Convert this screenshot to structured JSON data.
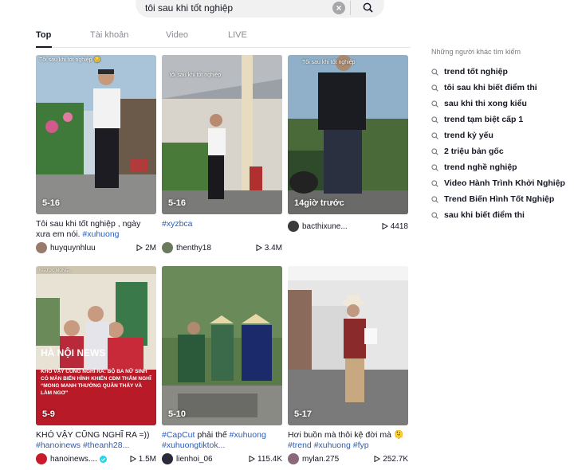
{
  "search": {
    "query": "tôi sau khi tốt nghiệp"
  },
  "tabs": [
    {
      "label": "Top"
    },
    {
      "label": "Tài khoản"
    },
    {
      "label": "Video"
    },
    {
      "label": "LIVE"
    }
  ],
  "videos": [
    {
      "date": "5-16",
      "overlay": "Tôi sau khi tốt nghiệp 😔",
      "desc_text": "Tôi sau khi tốt nghiệp , ngày xưa em nói. ",
      "desc_tags": "#xuhuong",
      "author": "huyquynhluu",
      "views": "2M"
    },
    {
      "date": "5-16",
      "overlay": "tôi sau khi tốt nghiệp",
      "desc_text": "",
      "desc_tags": "#xyzbca",
      "author": "thenthy18",
      "views": "3.4M"
    },
    {
      "date": "14giờ trước",
      "overlay": "Tôi sau khi tốt nghiệp",
      "desc_text": "",
      "desc_tags": "",
      "author": "bacthixune...",
      "views": "4418"
    },
    {
      "date": "5-9",
      "overlay": "NGƯỢC MONG...",
      "news_title": "HÀ NỘI NEWS",
      "news_sub": "KHÓ VẬY CŨNG NGHĨ RA: BỘ BA NỮ SINH CÓ MÀN BIẾN HÌNH KHIẾN CĐM THẮM NGHĨ “MONG MANH THƯỜNG QUÂN THẤY VÀ LÀM NGƠ”",
      "desc_text": "KHÓ VẬY CŨNG NGHĨ RA =)) ",
      "desc_tags": "#hanoinews #theanh28...",
      "author": "hanoinews....",
      "verified": true,
      "views": "1.5M"
    },
    {
      "date": "5-10",
      "overlay": "",
      "desc_text": "",
      "desc_tags_lead": "#CapCut",
      "desc_text_mid": " phải thế ",
      "desc_tags": "#xuhuong #xuhuongtiktok...",
      "author": "lienhoi_06",
      "views": "115.4K"
    },
    {
      "date": "5-17",
      "overlay": "",
      "desc_text": "Hơi buồn mà thôi kệ đời mà 🫠 ",
      "desc_tags": "#trend #xuhuong #fyp",
      "author": "mylan.275",
      "views": "252.7K"
    }
  ],
  "related": {
    "title": "Những người khác tìm kiếm",
    "items": [
      "trend tốt nghiệp",
      "tôi sau khi biết điểm thi",
      "sau khi thi xong kiểu",
      "trend tạm biệt cấp 1",
      "trend kỷ yếu",
      "2 triệu bản gốc",
      "trend nghề nghiệp",
      "Video Hành Trình Khởi Nghiệp",
      "Trend Biến Hình Tốt Nghiệp",
      "sau khi biết điểm thi"
    ]
  },
  "colors": {
    "accent": "#161823",
    "hashtag": "#2b5db9",
    "muted": "#8a8b91",
    "verified": "#20d5ec"
  }
}
